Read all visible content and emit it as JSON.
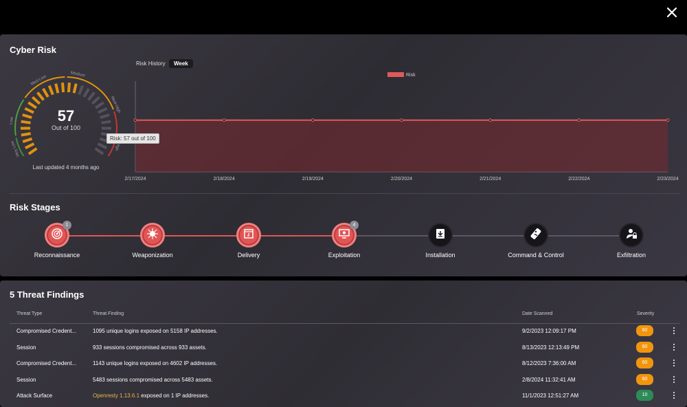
{
  "cyber_risk": {
    "title": "Cyber Risk",
    "score": "57",
    "out_of": "Out of 100",
    "last_updated": "Last updated 4 months ago",
    "tooltip": "Risk: 57 out of 100",
    "gauge_bands": [
      "Low",
      "Med-Low",
      "Medium",
      "Med-High",
      "High"
    ],
    "gauge_extra": [
      "Very Low"
    ]
  },
  "risk_history": {
    "label": "Risk History",
    "tab": "Week",
    "legend": "Risk",
    "color": "#e05a5a"
  },
  "chart_data": {
    "type": "area",
    "x": [
      "2/17/2024",
      "2/18/2024",
      "2/19/2024",
      "2/20/2024",
      "2/21/2024",
      "2/22/2024",
      "2/23/2024"
    ],
    "series": [
      {
        "name": "Risk",
        "values": [
          57,
          57,
          57,
          57,
          57,
          57,
          57
        ]
      }
    ],
    "ylim": [
      0,
      100
    ],
    "legend_position": "top-center",
    "grid": false
  },
  "risk_stages": {
    "title": "Risk Stages",
    "stages": [
      {
        "label": "Reconnaissance",
        "badge": "1",
        "active": true,
        "icon": "radar-icon"
      },
      {
        "label": "Weaponization",
        "badge": "",
        "active": true,
        "icon": "virus-icon"
      },
      {
        "label": "Delivery",
        "badge": "",
        "active": true,
        "icon": "package-icon"
      },
      {
        "label": "Exploitation",
        "badge": "4",
        "active": true,
        "icon": "monitor-bug-icon"
      },
      {
        "label": "Installation",
        "badge": "",
        "active": false,
        "icon": "download-icon"
      },
      {
        "label": "Command & Control",
        "badge": "",
        "active": false,
        "icon": "remote-icon"
      },
      {
        "label": "Exfiltration",
        "badge": "",
        "active": false,
        "icon": "user-lock-icon"
      }
    ]
  },
  "findings": {
    "title": "5 Threat Findings",
    "columns": [
      "Threat Type",
      "Threat Finding",
      "Date Scanned",
      "Severity"
    ],
    "rows": [
      {
        "type": "Compromised Credent...",
        "finding": "1095 unique logins exposed on 5158 IP addresses.",
        "link": "",
        "date": "9/2/2023 12:09:17 PM",
        "severity": "60",
        "color": "#f0960e"
      },
      {
        "type": "Session",
        "finding": "933 sessions compromised across 933 assets.",
        "link": "",
        "date": "8/13/2023 12:13:49 PM",
        "severity": "60",
        "color": "#f0960e"
      },
      {
        "type": "Compromised Credent...",
        "finding": "1143 unique logins exposed on 4602 IP addresses.",
        "link": "",
        "date": "8/12/2023 7:36:00 AM",
        "severity": "60",
        "color": "#f0960e"
      },
      {
        "type": "Session",
        "finding": "5483 sessions compromised across 5483 assets.",
        "link": "",
        "date": "2/8/2024 11:32:41 AM",
        "severity": "60",
        "color": "#f0960e"
      },
      {
        "type": "Attack Surface",
        "finding": " exposed on 1 IP addresses.",
        "link": "Openresty 1.13.6.1",
        "date": "11/1/2023 12:51:27 AM",
        "severity": "10",
        "color": "#2e8b57"
      }
    ]
  }
}
